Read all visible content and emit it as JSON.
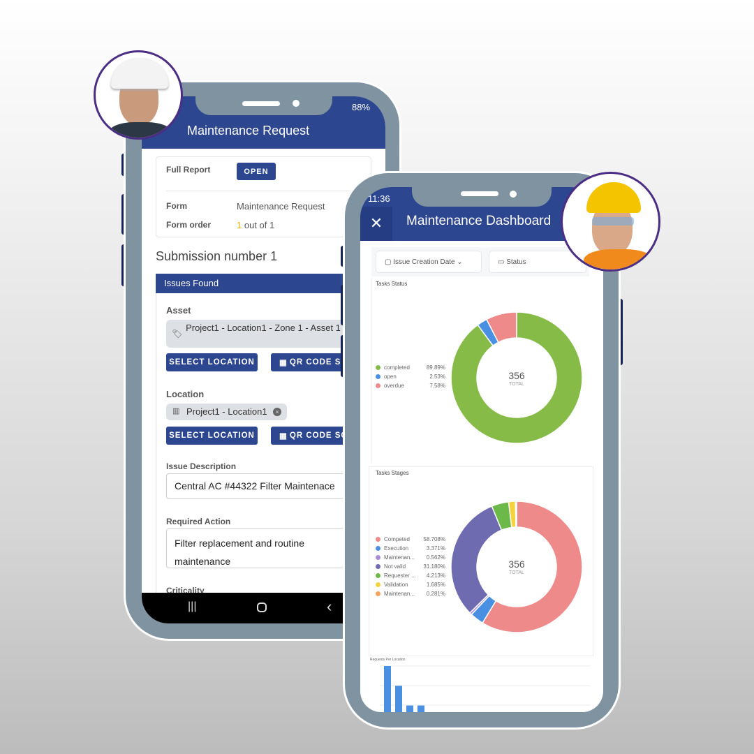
{
  "left_phone": {
    "status": {
      "battery": "88%"
    },
    "header_title": "Maintenance Request",
    "full_report_label": "Full Report",
    "open_button": "OPEN",
    "form_label": "Form",
    "form_value": "Maintenance Request",
    "form_order_label": "Form order",
    "form_order_current": "1",
    "form_order_rest": "out of 1",
    "submission_title": "Submission number 1",
    "section_title": "Issues Found",
    "asset_label": "Asset",
    "asset_value": "Project1 - Location1 - Zone 1 - Asset 1",
    "select_location_button": "SELECT LOCATION",
    "qr_button": "QR CODE SCA",
    "location_label": "Location",
    "location_value": "Project1 - Location1",
    "issue_description_label": "Issue Description",
    "issue_description_value": "Central AC #44322 Filter Maintenace",
    "required_action_label": "Required Action",
    "required_action_value": "Filter replacement and routine maintenance",
    "criticality_label": "Criticality"
  },
  "right_phone": {
    "status": {
      "time": "11:36"
    },
    "header_title": "Maintenance Dashboard",
    "filters": [
      {
        "label": "Issue Creation Date",
        "icon": "calendar-icon"
      },
      {
        "label": "Status",
        "icon": "tag-icon"
      }
    ],
    "colors": {
      "header": "#2c4690",
      "frame": "#7f93a1",
      "avatar_border": "#4b2d83"
    }
  },
  "chart_data": [
    {
      "type": "pie",
      "title": "Tasks Status",
      "center_value": "356",
      "center_label": "TOTAL",
      "legend_position": "left",
      "slices": [
        {
          "name": "completed",
          "value": 89.89,
          "label": "89.89%",
          "color": "#86bb48"
        },
        {
          "name": "open",
          "value": 2.53,
          "label": "2.53%",
          "color": "#4a90e2"
        },
        {
          "name": "overdue",
          "value": 7.58,
          "label": "7.58%",
          "color": "#ef8a8a"
        }
      ]
    },
    {
      "type": "pie",
      "title": "Tasks Stages",
      "center_value": "356",
      "center_label": "TOTAL",
      "legend_position": "left",
      "slices": [
        {
          "name": "Competed",
          "value": 58.708,
          "label": "58.708%",
          "color": "#ef8a8a"
        },
        {
          "name": "Execution",
          "value": 3.371,
          "label": "3.371%",
          "color": "#4a90e2"
        },
        {
          "name": "Maintenan...",
          "value": 0.562,
          "label": "0.562%",
          "color": "#a98bd8"
        },
        {
          "name": "Not valid",
          "value": 31.18,
          "label": "31.180%",
          "color": "#6f6bb0"
        },
        {
          "name": "Requester ...",
          "value": 4.213,
          "label": "4.213%",
          "color": "#6cb94a"
        },
        {
          "name": "Validation",
          "value": 1.685,
          "label": "1.685%",
          "color": "#f5d33c"
        },
        {
          "name": "Maintenan...",
          "value": 0.281,
          "label": "0.281%",
          "color": "#f2a35e"
        }
      ]
    },
    {
      "type": "bar",
      "title": "Requests Per Location",
      "values": [
        7,
        4,
        1,
        1
      ],
      "ylim": [
        0,
        7
      ],
      "color": "#4a90e2"
    }
  ]
}
